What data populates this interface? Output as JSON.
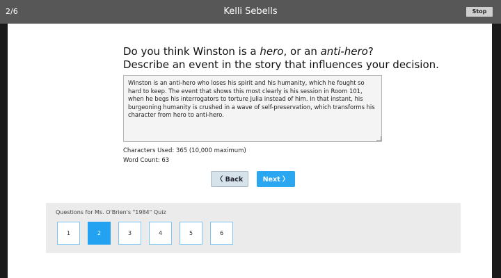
{
  "header": {
    "counter": "2/6",
    "title": "Kelli Sebells",
    "stop_label": "Stop"
  },
  "question": {
    "line1_pre": "Do you think Winston is a ",
    "line1_em1": "hero",
    "line1_mid": ", or an ",
    "line1_em2": "anti-hero",
    "line1_post": "?",
    "line2": "Describe an event in the story that influences your decision."
  },
  "answer": {
    "text": "Winston is an anti-hero who loses his spirit and his humanity, which he fought so hard to keep. The event that shows this most clearly is his session in Room 101, when he begs his interrogators to torture Julia instead of him. In that instant, his burgeoning humanity is crushed in a wave of self-preservation, which transforms his character from hero to anti-hero."
  },
  "meta": {
    "characters": "Characters Used: 365 (10,000 maximum)",
    "words": "Word Count: 63"
  },
  "nav_buttons": {
    "back_label": "〈 Back",
    "next_label": "Next 〉"
  },
  "question_nav": {
    "label": "Questions for Ms. O'Brien's \"1984\" Quiz",
    "items": [
      "1",
      "2",
      "3",
      "4",
      "5",
      "6"
    ],
    "active_index": 1
  }
}
